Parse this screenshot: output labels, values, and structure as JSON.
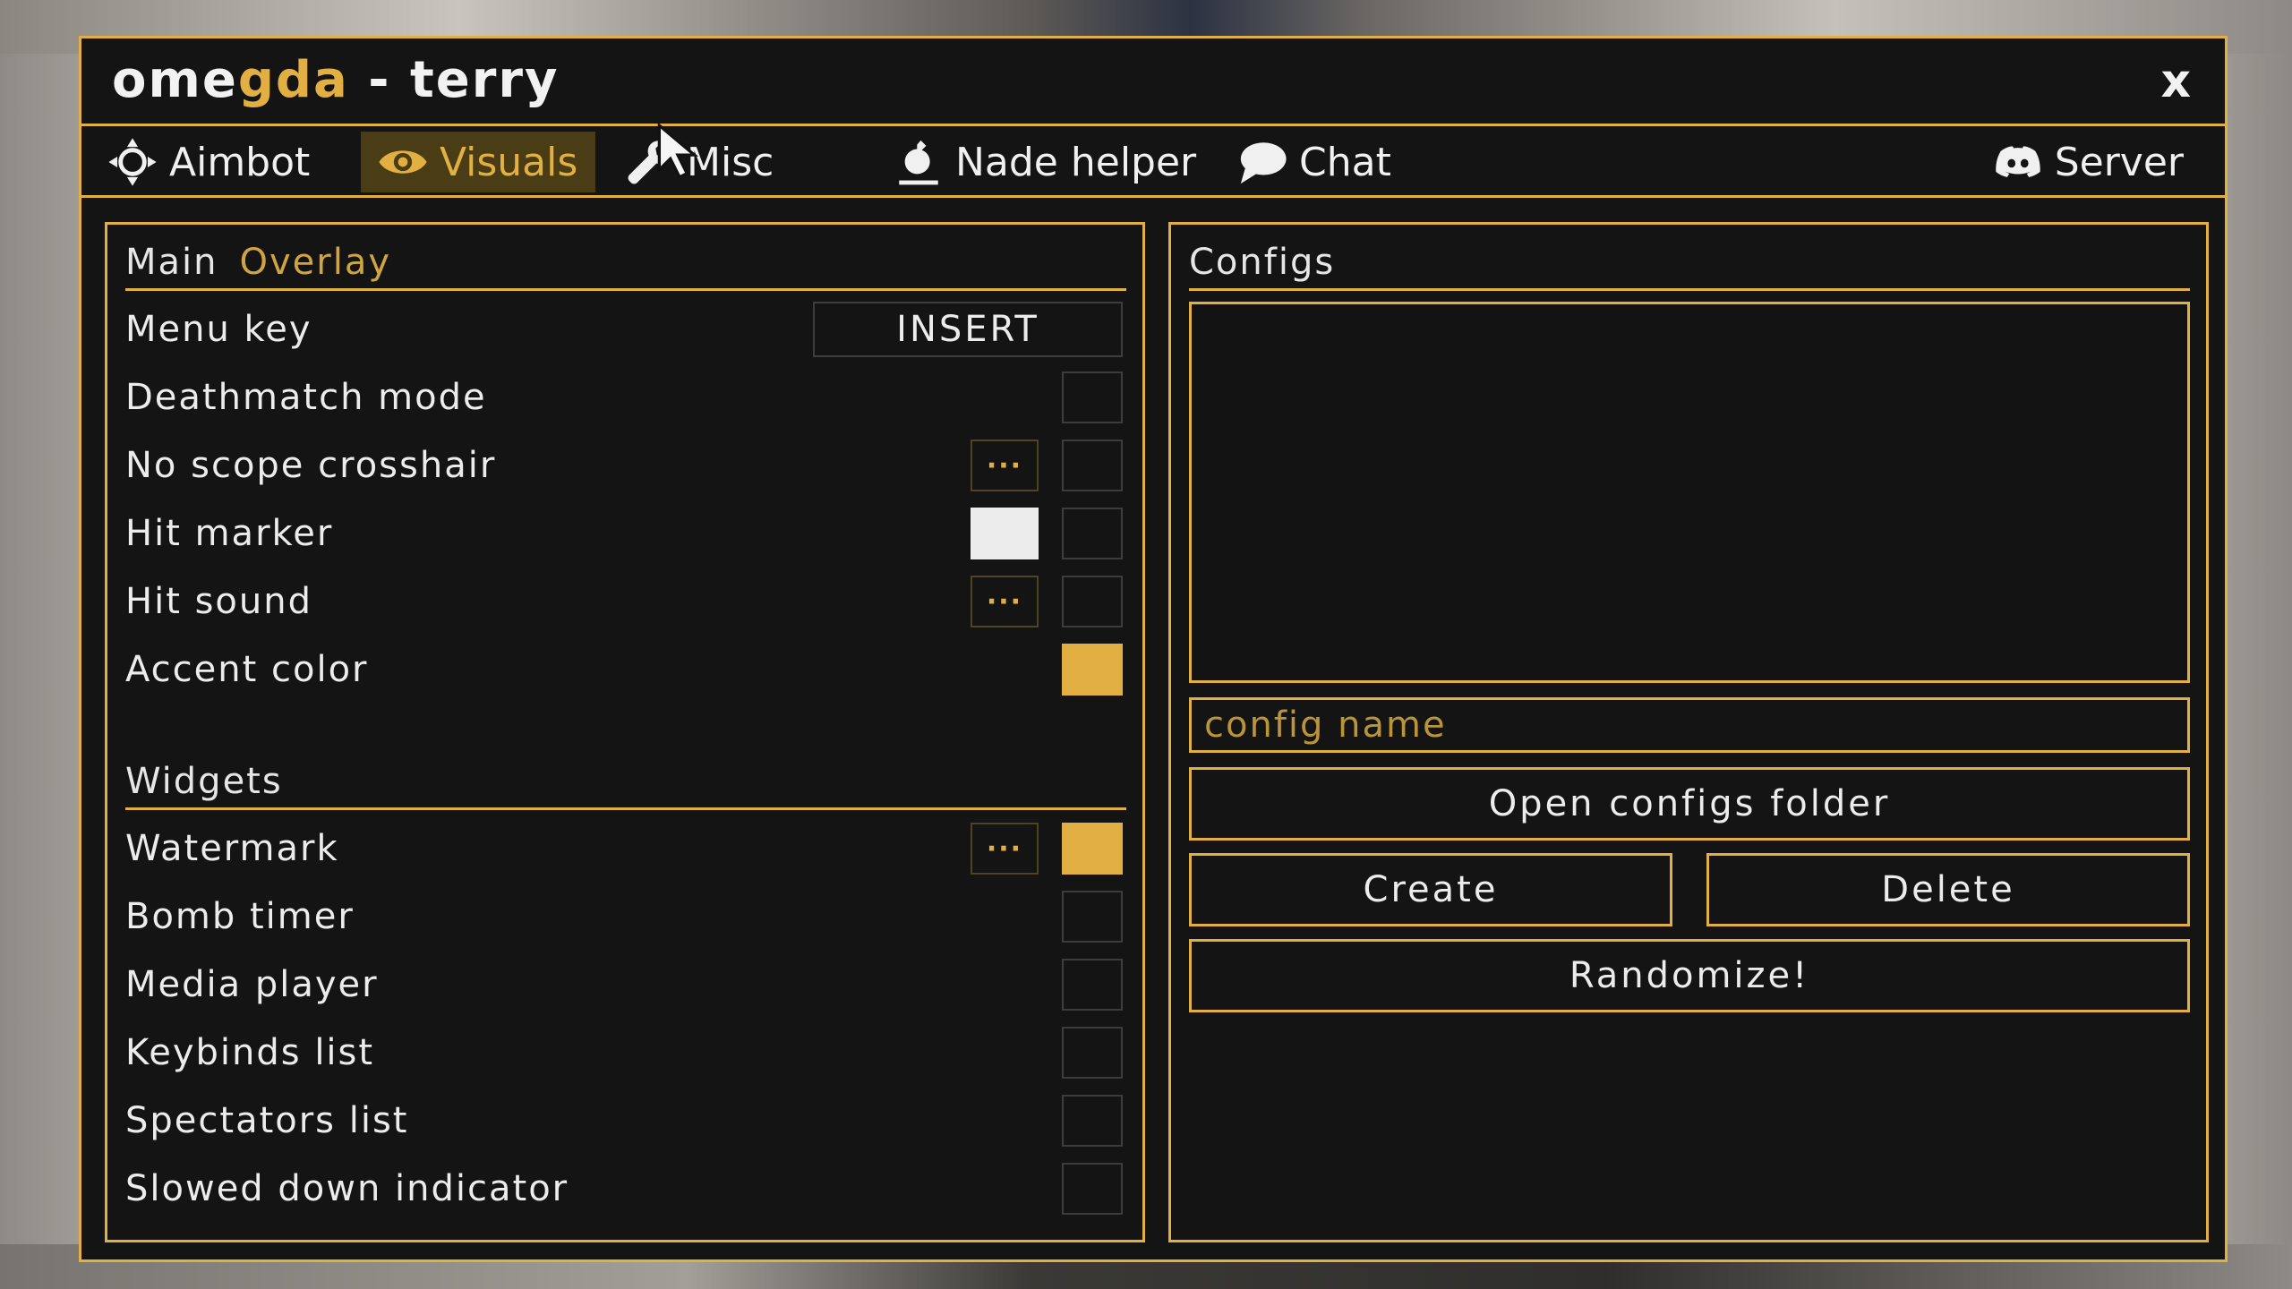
{
  "window": {
    "title_part1": "ome",
    "title_accent": "gda",
    "title_part2": " - terry",
    "close_label": "x"
  },
  "colors": {
    "accent": "#e2b042",
    "background": "#141414",
    "text": "#ececec",
    "hit_marker_color": "#ececec"
  },
  "tabs": [
    {
      "label": "Aimbot",
      "icon": "crosshair-icon"
    },
    {
      "label": "Visuals",
      "icon": "eye-icon",
      "active": true
    },
    {
      "label": "Misc",
      "icon": "wrench-icon"
    },
    {
      "label": "Nade helper",
      "icon": "grenade-icon"
    },
    {
      "label": "Chat",
      "icon": "chat-bubble-icon"
    },
    {
      "label": "Server",
      "icon": "discord-icon"
    }
  ],
  "left": {
    "main_section": {
      "title": "Main",
      "subtitle": "Overlay"
    },
    "main_rows": [
      {
        "label": "Menu key",
        "value": "INSERT"
      },
      {
        "label": "Deathmatch mode",
        "checked": false
      },
      {
        "label": "No scope crosshair",
        "options": "···",
        "checked": false
      },
      {
        "label": "Hit marker",
        "checked": false
      },
      {
        "label": "Hit sound",
        "options": "···",
        "checked": false
      },
      {
        "label": "Accent color"
      }
    ],
    "widgets_section": {
      "title": "Widgets"
    },
    "widget_rows": [
      {
        "label": "Watermark",
        "options": "···",
        "checked": true
      },
      {
        "label": "Bomb timer",
        "checked": false
      },
      {
        "label": "Media player",
        "checked": false
      },
      {
        "label": "Keybinds list",
        "checked": false
      },
      {
        "label": "Spectators list",
        "checked": false
      },
      {
        "label": "Slowed down indicator",
        "checked": false
      }
    ]
  },
  "right": {
    "configs_section": {
      "title": "Configs"
    },
    "config_name_placeholder": "config name",
    "open_folder_label": "Open configs folder",
    "create_label": "Create",
    "delete_label": "Delete",
    "randomize_label": "Randomize!"
  }
}
